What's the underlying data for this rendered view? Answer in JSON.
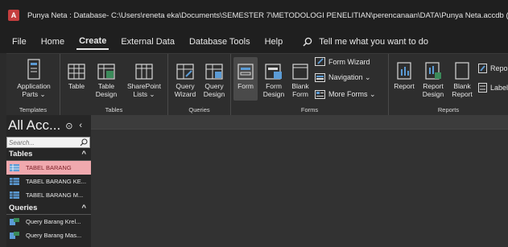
{
  "titlebar": {
    "icon_letter": "A",
    "title": "Punya Neta : Database- C:\\Users\\reneta eka\\Documents\\SEMESTER 7\\METODOLOGI PENELITIAN\\perencanaan\\DATA\\Punya Neta.accdb (Access 2"
  },
  "menu": {
    "tabs": [
      "File",
      "Home",
      "Create",
      "External Data",
      "Database Tools",
      "Help"
    ],
    "active_tab": "Create",
    "tell_me": "Tell me what you want to do"
  },
  "ribbon": {
    "templates": {
      "label": "Templates",
      "application_parts": "Application",
      "application_parts_2": "Parts ⌄"
    },
    "tables": {
      "label": "Tables",
      "table": "Table",
      "table_design_1": "Table",
      "table_design_2": "Design",
      "sharepoint_1": "SharePoint",
      "sharepoint_2": "Lists ⌄"
    },
    "queries": {
      "label": "Queries",
      "wizard_1": "Query",
      "wizard_2": "Wizard",
      "design_1": "Query",
      "design_2": "Design"
    },
    "forms": {
      "label": "Forms",
      "form": "Form",
      "form_design_1": "Form",
      "form_design_2": "Design",
      "blank_form_1": "Blank",
      "blank_form_2": "Form",
      "form_wizard": "Form Wizard",
      "navigation": "Navigation ⌄",
      "more_forms": "More Forms ⌄"
    },
    "reports": {
      "label": "Reports",
      "report": "Report",
      "report_design_1": "Report",
      "report_design_2": "Design",
      "blank_report_1": "Blank",
      "blank_report_2": "Report",
      "report_wizard": "Report",
      "labels": "Labels"
    }
  },
  "navpane": {
    "title": "All Acc...",
    "search_placeholder": "Search...",
    "sections": [
      {
        "name": "Tables",
        "items": [
          "TABEL BARANG",
          "TABEL BARANG KE...",
          "TABEL BARANG M..."
        ]
      },
      {
        "name": "Queries",
        "items": [
          "Query Barang Krel...",
          "Query Barang Mas..."
        ]
      }
    ]
  },
  "colors": {
    "accent_red": "#c43e3e",
    "selected_item_bg": "#f0a9ae",
    "icon_blue": "#5b9bd5"
  }
}
